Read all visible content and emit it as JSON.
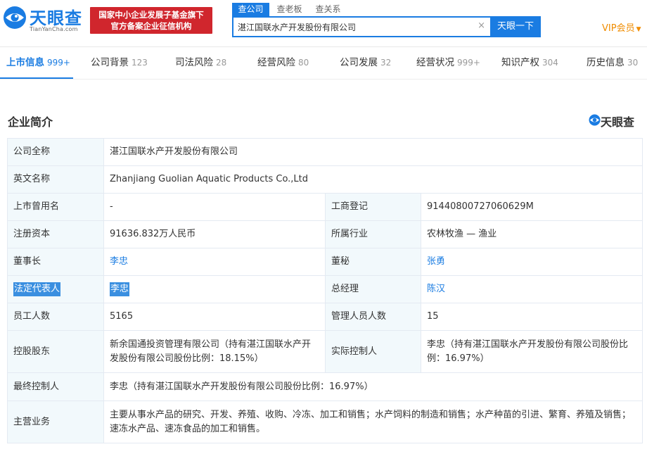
{
  "header": {
    "logo_cn": "天眼查",
    "logo_en": "TianYanCha.com",
    "banner_line1": "国家中小企业发展子基金旗下",
    "banner_line2": "官方备案企业征信机构",
    "search_tabs": [
      "查公司",
      "查老板",
      "查关系"
    ],
    "search_value": "湛江国联水产开发股份有限公司",
    "clear_glyph": "×",
    "search_button": "天眼一下",
    "vip_label": "VIP会员",
    "vip_caret": "▼"
  },
  "nav": [
    {
      "label": "上市信息",
      "count": "999+"
    },
    {
      "label": "公司背景",
      "count": "123"
    },
    {
      "label": "司法风险",
      "count": "28"
    },
    {
      "label": "经营风险",
      "count": "80"
    },
    {
      "label": "公司发展",
      "count": "32"
    },
    {
      "label": "经营状况",
      "count": "999+"
    },
    {
      "label": "知识产权",
      "count": "304"
    },
    {
      "label": "历史信息",
      "count": "30"
    }
  ],
  "section": {
    "title": "企业简介",
    "brand": "天眼查"
  },
  "info": {
    "full_name_label": "公司全称",
    "full_name": "湛江国联水产开发股份有限公司",
    "english_name_label": "英文名称",
    "english_name": "Zhanjiang Guolian Aquatic Products Co.,Ltd",
    "former_name_label": "上市曾用名",
    "former_name": "-",
    "reg_no_label": "工商登记",
    "reg_no": "91440800727060629M",
    "capital_label": "注册资本",
    "capital": "91636.832万人民币",
    "industry_label": "所属行业",
    "industry": "农林牧渔 — 渔业",
    "chairman_label": "董事长",
    "chairman": "李忠",
    "secretary_label": "董秘",
    "secretary": "张勇",
    "legal_rep_label": "法定代表人",
    "legal_rep": "李忠",
    "gm_label": "总经理",
    "gm": "陈汉",
    "employees_label": "员工人数",
    "employees": "5165",
    "managers_label": "管理人员人数",
    "managers": "15",
    "controlling_holder_label": "控股股东",
    "controlling_holder": "新余国通投资管理有限公司（持有湛江国联水产开发股份有限公司股份比例：18.15%）",
    "actual_controller_label": "实际控制人",
    "actual_controller": "李忠（持有湛江国联水产开发股份有限公司股份比例：16.97%）",
    "ultimate_controller_label": "最终控制人",
    "ultimate_controller": "李忠（持有湛江国联水产开发股份有限公司股份比例：16.97%）",
    "main_business_label": "主营业务",
    "main_business": "主要从事水产品的研究、开发、养殖、收购、冷冻、加工和销售；水产饲料的制造和销售；水产种苗的引进、繁育、养殖及销售；速冻水产品、速冻食品的加工和销售。"
  },
  "colors": {
    "brand_blue": "#1a7ce2",
    "banner_red": "#d0262d",
    "vip_orange": "#f08c00",
    "label_bg": "#f2f9fc"
  }
}
